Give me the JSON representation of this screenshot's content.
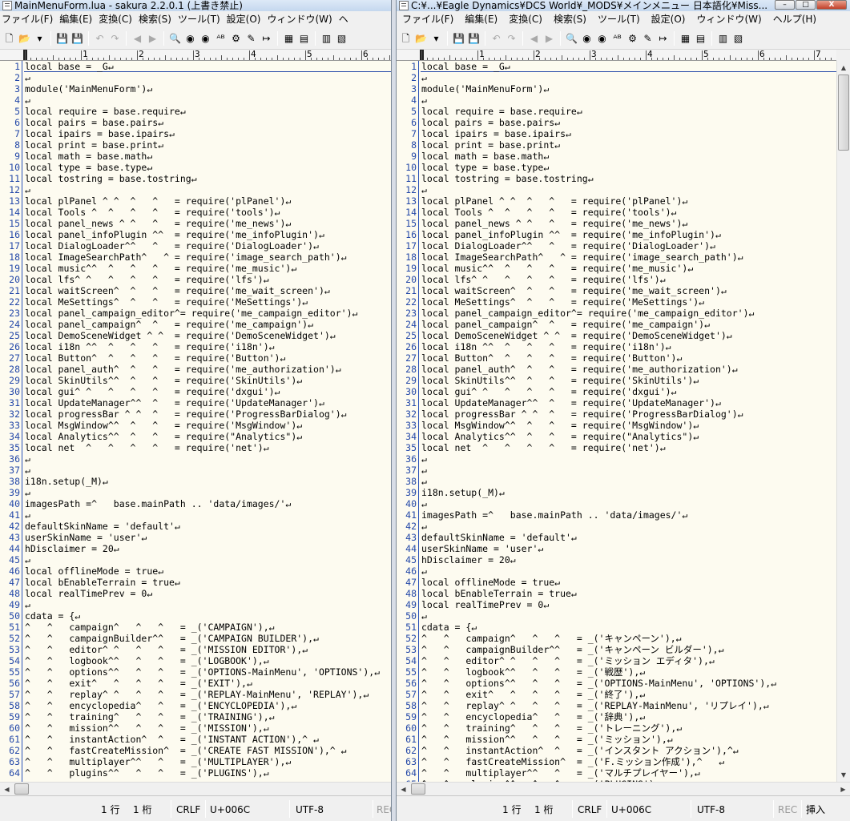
{
  "left_window": {
    "title": "MainMenuForm.lua - sakura 2.2.0.1 (上書き禁止)",
    "menu": [
      "ファイル(F)",
      "編集(E)",
      "変換(C)",
      "検索(S)",
      "ツール(T)",
      "設定(O)",
      "ウィンドウ(W)",
      "ヘ"
    ],
    "ruler_labels": [
      "1",
      "2",
      "3",
      "4",
      "5",
      "6"
    ],
    "status": {
      "row": "1 行",
      "col": "1 桁",
      "eol": "CRLF",
      "unicode": "U+006C",
      "encoding": "UTF-8",
      "rec": "REC"
    }
  },
  "right_window": {
    "title": "C:¥...¥Eagle Dynamics¥DCS World¥_MODS¥メインメニュー 日本語化¥Miss...",
    "menu": [
      "ファイル(F)",
      "編集(E)",
      "変換(C)",
      "検索(S)",
      "ツール(T)",
      "設定(O)",
      "ウィンドウ(W)",
      "ヘルプ(H)"
    ],
    "ruler_labels": [
      "1",
      "2",
      "3",
      "4",
      "5",
      "6",
      "7"
    ],
    "status": {
      "row": "1 行",
      "col": "1 桁",
      "eol": "CRLF",
      "unicode": "U+006C",
      "encoding": "UTF-8",
      "rec": "REC",
      "mode": "挿入"
    }
  },
  "caption_buttons": {
    "minimize": "–",
    "maximize": "□",
    "close": "X"
  },
  "toolbar_icons": [
    "new-file-icon",
    "open-file-icon",
    "dropdown-icon",
    "save-icon",
    "save-as-icon",
    "undo-icon",
    "redo-icon",
    "jump-back-icon",
    "jump-forward-icon",
    "search-icon",
    "search-prev-icon",
    "search-next-icon",
    "replace-icon",
    "grep-icon",
    "grep-replace-icon",
    "tag-jump-icon",
    "outline-icon",
    "window-split-icon",
    "print-icon",
    "print-preview-icon"
  ],
  "toolbar_glyphs": {
    "new-file-icon": "🗋",
    "open-file-icon": "📂",
    "dropdown-icon": "▾",
    "save-icon": "💾",
    "save-as-icon": "💾",
    "undo-icon": "↶",
    "redo-icon": "↷",
    "jump-back-icon": "◀",
    "jump-forward-icon": "▶",
    "search-icon": "🔍",
    "search-prev-icon": "◉",
    "search-next-icon": "◉",
    "replace-icon": "ᴬᴮ",
    "grep-icon": "⚙",
    "grep-replace-icon": "✎",
    "tag-jump-icon": "↦",
    "outline-icon": "▦",
    "window-split-icon": "▤",
    "print-icon": "▥",
    "print-preview-icon": "▧"
  },
  "common_lines": [
    "local base = _G↵",
    "↵",
    "module('MainMenuForm')↵",
    "↵",
    "local require = base.require↵",
    "local pairs = base.pairs↵",
    "local ipairs = base.ipairs↵",
    "local print = base.print↵",
    "local math = base.math↵",
    "local type = base.type↵",
    "local tostring = base.tostring↵",
    "↵",
    "local plPanel ^ ^  ^   ^   = require('plPanel')↵",
    "local Tools ^  ^   ^   ^   = require('tools')↵",
    "local panel_news ^ ^   ^   = require('me_news')↵",
    "local panel_infoPlugin ^^  = require('me_infoPlugin')↵",
    "local DialogLoader^^   ^   = require('DialogLoader')↵",
    "local ImageSearchPath^   ^ = require('image_search_path')↵",
    "local music^^  ^   ^   ^   = require('me_music')↵",
    "local lfs^ ^   ^   ^   ^   = require('lfs')↵",
    "local waitScreen^  ^   ^   = require('me_wait_screen')↵",
    "local MeSettings^  ^   ^   = require('MeSettings')↵",
    "local panel_campaign_editor^= require('me_campaign_editor')↵",
    "local panel_campaign^  ^   = require('me_campaign')↵",
    "local DemoSceneWidget ^ ^  = require('DemoSceneWidget')↵",
    "local i18n ^^  ^   ^   ^   = require('i18n')↵",
    "local Button^  ^   ^   ^   = require('Button')↵",
    "local panel_auth^  ^   ^   = require('me_authorization')↵",
    "local SkinUtils^^  ^   ^   = require('SkinUtils')↵",
    "local gui^ ^   ^   ^   ^   = require('dxgui')↵",
    "local UpdateManager^^  ^   = require('UpdateManager')↵",
    "local progressBar ^ ^  ^   = require('ProgressBarDialog')↵",
    "local MsgWindow^^  ^   ^   = require('MsgWindow')↵",
    "local Analytics^^  ^   ^   = require(\"Analytics\")↵",
    "local net  ^   ^   ^   ^   = require('net')↵",
    "↵"
  ],
  "left_lines_tail": [
    "↵",
    "i18n.setup(_M)↵",
    "↵",
    "imagesPath =^   base.mainPath .. 'data/images/'↵",
    "↵",
    "defaultSkinName = 'default'↵",
    "userSkinName = 'user'↵",
    "hDisclaimer = 20↵",
    "↵",
    "local offlineMode = true↵",
    "local bEnableTerrain = true↵",
    "local realTimePrev = 0↵",
    "↵",
    "cdata = {↵",
    "^   ^   campaign^   ^   ^   = _('CAMPAIGN'),↵",
    "^   ^   campaignBuilder^^   = _('CAMPAIGN BUILDER'),↵",
    "^   ^   editor^ ^   ^   ^   = _('MISSION EDITOR'),↵",
    "^   ^   logbook^^   ^   ^   = _('LOGBOOK'),↵",
    "^   ^   options^^   ^   ^   = _('OPTIONS-MainMenu', 'OPTIONS'),↵",
    "^   ^   exit^   ^   ^   ^   = _('EXIT'),↵",
    "^   ^   replay^ ^   ^   ^   = _('REPLAY-MainMenu', 'REPLAY'),↵",
    "^   ^   encyclopedia^   ^   = _('ENCYCLOPEDIA'),↵",
    "^   ^   training^   ^   ^   = _('TRAINING'),↵",
    "^   ^   mission^^   ^   ^   = _('MISSION'),↵",
    "^   ^   instantAction^  ^   = _('INSTANT ACTION'),^ ↵",
    "^   ^   fastCreateMission^  = _('CREATE FAST MISSION'),^ ↵",
    "^   ^   multiplayer^^   ^   = _('MULTIPLAYER'),↵",
    "^   ^   plugins^^   ^   ^   = _('PLUGINS'),↵"
  ],
  "right_lines_tail": [
    "↵",
    "↵",
    "i18n.setup(_M)↵",
    "↵",
    "imagesPath =^   base.mainPath .. 'data/images/'↵",
    "↵",
    "defaultSkinName = 'default'↵",
    "userSkinName = 'user'↵",
    "hDisclaimer = 20↵",
    "↵",
    "local offlineMode = true↵",
    "local bEnableTerrain = true↵",
    "local realTimePrev = 0↵",
    "↵",
    "cdata = {↵",
    "^   ^   campaign^   ^   ^   = _('キャンペーン'),↵",
    "^   ^   campaignBuilder^^   = _('キャンペーン ビルダー'),↵",
    "^   ^   editor^ ^   ^   ^   = _('ミッション エディタ'),↵",
    "^   ^   logbook^^   ^   ^   = _('戦歴'),↵",
    "^   ^   options^^   ^   ^   = _('OPTIONS-MainMenu', 'OPTIONS'),↵",
    "^   ^   exit^   ^   ^   ^   = _('終了'),↵",
    "^   ^   replay^ ^   ^   ^   = _('REPLAY-MainMenu', 'リプレイ'),↵",
    "^   ^   encyclopedia^   ^   = _('辞典'),↵",
    "^   ^   training^   ^   ^   = _('トレーニング'),↵",
    "^   ^   mission^^   ^   ^   = _('ミッション'),↵",
    "^   ^   instantAction^  ^   = _('インスタント アクション'),^↵",
    "^   ^   fastCreateMission^  = _('F.ミッション作成'),^   ↵",
    "^   ^   multiplayer^^   ^   = _('マルチプレイヤー'),↵",
    "^   ^   plugins^^   ^   ^   = _('PLUGINS'),↵"
  ]
}
